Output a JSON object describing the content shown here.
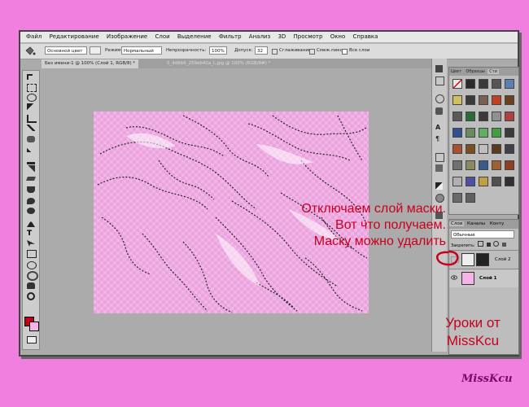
{
  "menubar": {
    "items": [
      "Файл",
      "Редактирование",
      "Изображение",
      "Слои",
      "Выделение",
      "Фильтр",
      "Анализ",
      "3D",
      "Просмотр",
      "Окно",
      "Справка"
    ]
  },
  "options": {
    "fill_source": "Основной цвет",
    "mode_label": "Режим:",
    "mode_value": "Нормальный",
    "opacity_label": "Непрозрачность:",
    "opacity_value": "100%",
    "tolerance_label": "Допуск:",
    "tolerance_value": "32",
    "antialias_label": "Сглаживание",
    "contiguous_label": "Смеж.пикс",
    "all_layers_label": "Все слои"
  },
  "doc_tabs": [
    {
      "label": "Без имени-1 @ 100% (Слой 1, RGB/8) *",
      "active": true
    },
    {
      "label": "0_4d6b6_259eb42a_L.jpg @ 100% (RGB/8#) *",
      "active": false
    }
  ],
  "swatch_panel": {
    "tabs": [
      "Цвет",
      "Образцы",
      "Сти"
    ]
  },
  "layers_panel": {
    "tabs": [
      "Слои",
      "Каналы",
      "Конту"
    ],
    "blend_mode": "Обычные",
    "lock_label": "Закрепить:",
    "layers": [
      {
        "name": "Слой 2",
        "visible": false,
        "has_mask": true
      },
      {
        "name": "Слой 1",
        "visible": true,
        "has_mask": false
      }
    ]
  },
  "annotation": {
    "line1": "Отключаем слой маски.",
    "line2": "Вот что получаем.",
    "line3": "Маску можно удалить"
  },
  "footer": {
    "line1": "Уроки от",
    "line2": "MissKcu"
  },
  "signature": "MissKcu",
  "colors": {
    "background": "#f17fe0",
    "workspace": "#ababab",
    "annotation": "#c8001e",
    "foreground_swatch": "#c00018",
    "background_swatch": "#f5b4e8"
  }
}
